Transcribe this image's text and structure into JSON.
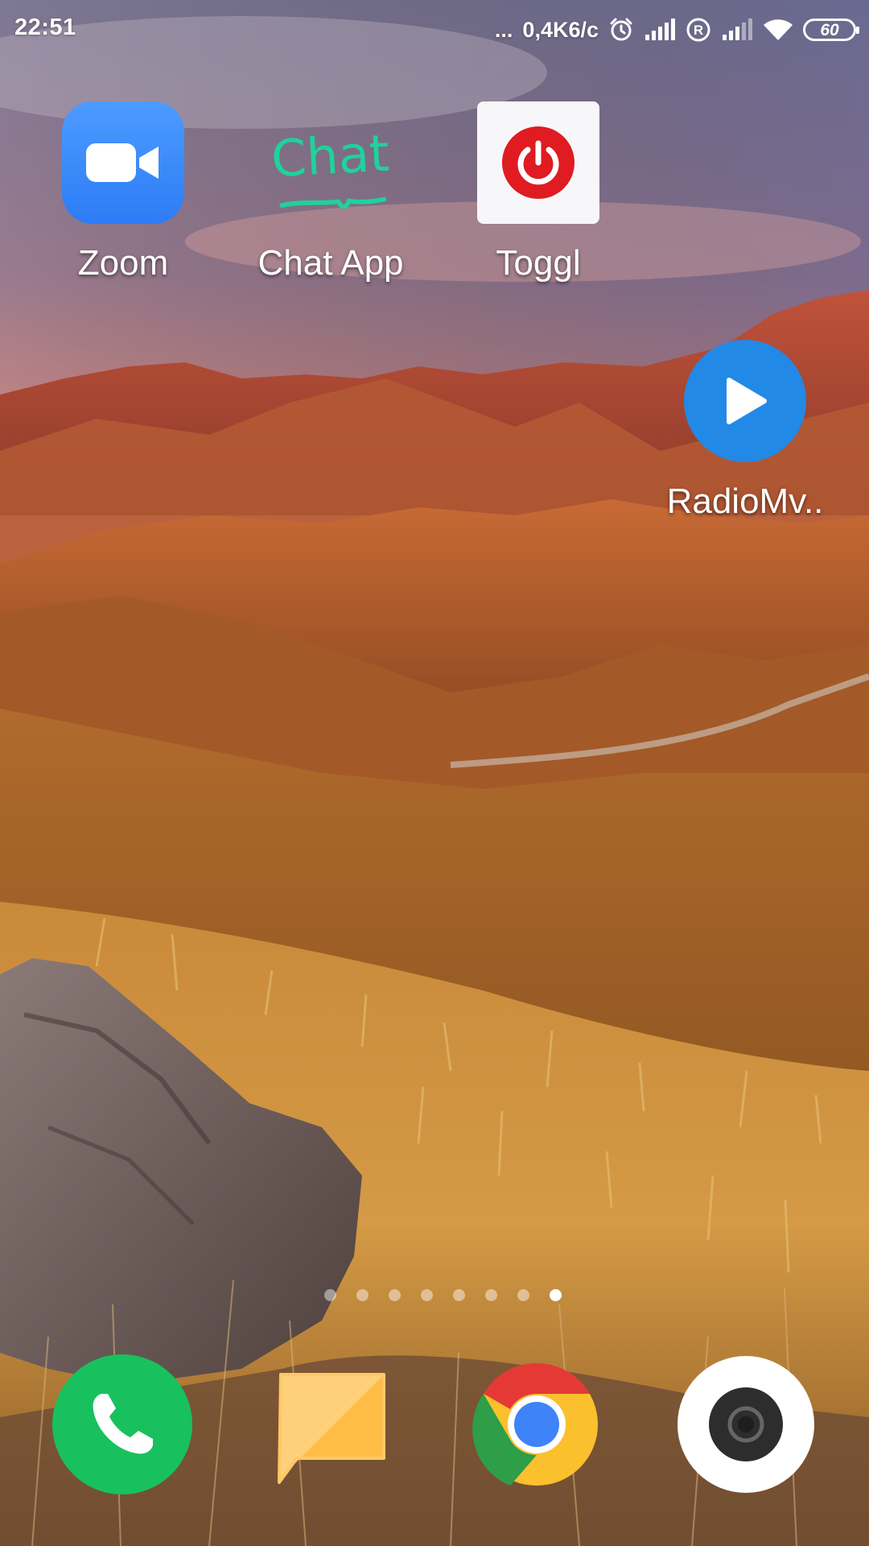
{
  "status_bar": {
    "time": "22:51",
    "more": "...",
    "network_speed": "0,4K6/c",
    "battery_level": "60",
    "icons": [
      "alarm-icon",
      "signal-icon",
      "roaming-icon",
      "signal-icon",
      "wifi-icon",
      "battery-icon"
    ]
  },
  "home": {
    "apps": [
      {
        "label": "Zoom",
        "icon": "zoom-icon",
        "color": "#2d8cff"
      },
      {
        "label": "Chat App",
        "icon": "chat-app-icon",
        "icon_text": "Chat",
        "color": "#1fd29c"
      },
      {
        "label": "Toggl",
        "icon": "toggl-power-icon",
        "color": "#e01b22"
      },
      {
        "label": "RadioMv..",
        "icon": "play-icon",
        "color": "#2389e6"
      }
    ]
  },
  "page_indicator": {
    "count": 8,
    "active_index": 7
  },
  "dock": {
    "apps": [
      {
        "icon": "phone-icon",
        "color": "#18c15d"
      },
      {
        "icon": "messages-icon",
        "color": "#ffbd45"
      },
      {
        "icon": "chrome-icon",
        "color": "#4285f4"
      },
      {
        "icon": "camera-icon",
        "color": "#ffffff"
      }
    ]
  }
}
